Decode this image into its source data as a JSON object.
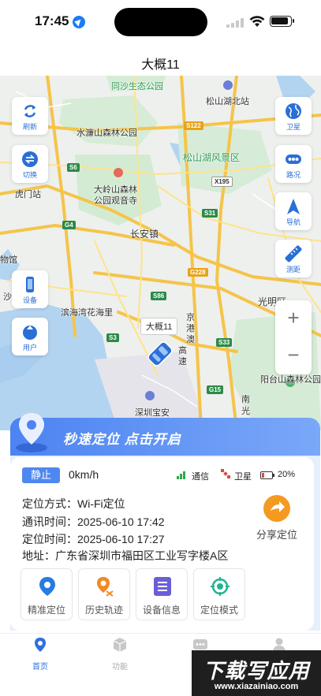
{
  "status_bar": {
    "time": "17:45"
  },
  "nav": {
    "title": "大概11"
  },
  "map": {
    "labels": {
      "tongsha": "同沙生态公园",
      "songshan_station": "松山湖北站",
      "shuilian": "水濂山森林公园",
      "songshanhu": "松山湖风景区",
      "daling": "大岭山森林",
      "daling2": "公园观音寺",
      "humen": "虎门站",
      "changan": "长安镇",
      "bay": "滨海湾花海里",
      "museum": "物馆",
      "guangming": "光明区",
      "yangtai": "阳台山森林公园",
      "airport": "深圳宝安",
      "jinggang1": "京",
      "jinggang2": "港",
      "jinggang3": "澳",
      "jinggang4": "高",
      "jinggang5": "速",
      "sha": "沙",
      "nan": "南",
      "guang": "光"
    },
    "shields": [
      "S122",
      "S6",
      "X195",
      "S31",
      "G4",
      "G228",
      "S86",
      "S3",
      "S33",
      "G15"
    ],
    "car_label": "大概11",
    "left_buttons": [
      {
        "label": "刷新",
        "icon": "refresh-icon"
      },
      {
        "label": "切换",
        "icon": "swap-icon"
      },
      {
        "label": "设备",
        "icon": "device-icon"
      },
      {
        "label": "用户",
        "icon": "user-icon"
      }
    ],
    "right_buttons": [
      {
        "label": "卫星",
        "icon": "globe-icon"
      },
      {
        "label": "路况",
        "icon": "traffic-icon"
      },
      {
        "label": "导航",
        "icon": "navigation-icon"
      },
      {
        "label": "测距",
        "icon": "ruler-icon"
      }
    ],
    "zoom_in": "+",
    "zoom_out": "−"
  },
  "promo": {
    "text": "秒速定位  点击开启"
  },
  "device_status": {
    "state": "静止",
    "speed": "0km/h",
    "comm_label": "通信",
    "sat_label": "卫星",
    "battery": "20%"
  },
  "details": {
    "method": "定位方式：Wi-Fi定位",
    "comm_time": "通讯时间：2025-06-10 17:42",
    "loc_time": "定位时间：2025-06-10 17:27",
    "address": "地址：广东省深圳市福田区工业写字楼A区"
  },
  "share": {
    "label": "分享定位"
  },
  "features": [
    {
      "label": "精准定位",
      "icon": "location-pin-icon"
    },
    {
      "label": "历史轨迹",
      "icon": "track-icon"
    },
    {
      "label": "设备信息",
      "icon": "list-icon"
    },
    {
      "label": "定位模式",
      "icon": "target-icon"
    }
  ],
  "tabs": [
    {
      "label": "首页",
      "icon": "home-pin-icon"
    },
    {
      "label": "功能",
      "icon": "box-icon"
    },
    {
      "label": "消息",
      "icon": "message-icon"
    },
    {
      "label": "我的",
      "icon": "person-icon"
    }
  ],
  "watermark": {
    "title": "下载写应用",
    "url": "www.xiazainiao.com"
  },
  "colors": {
    "accent": "#4f87f0",
    "orange": "#f59a20",
    "teal": "#1fb58f",
    "purple": "#6a5fd8",
    "green": "#2f9a58"
  }
}
